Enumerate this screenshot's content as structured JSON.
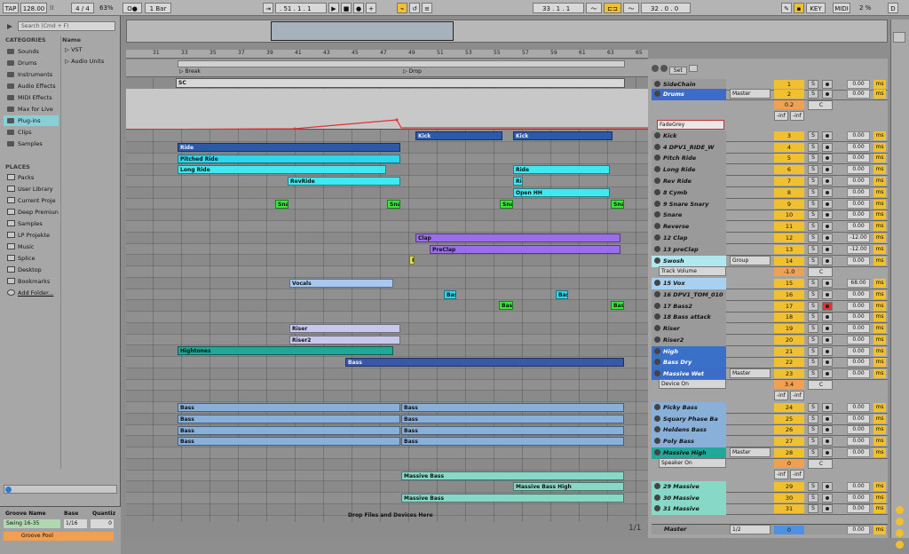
{
  "transport": {
    "tap": "TAP",
    "tempo": "128.00",
    "meter": "4 / 4",
    "zoom": "63%",
    "quantize": "1 Bar",
    "position": ". 51 .   1 .   1",
    "loop_start": "33 .   1 .   1",
    "loop_len": "32 .   0 .   0",
    "key": "KEY",
    "midi": "MIDI",
    "cpu": "2 %",
    "d": "D"
  },
  "browser": {
    "search_placeholder": "Search (Cmd + F)",
    "categories_title": "CATEGORIES",
    "categories": [
      "Sounds",
      "Drums",
      "Instruments",
      "Audio Effects",
      "MIDI Effects",
      "Max for Live",
      "Plug-ins",
      "Clips",
      "Samples"
    ],
    "name_header": "Name",
    "collection": [
      "VST",
      "Audio Units"
    ],
    "places_title": "PLACES",
    "places": [
      "Packs",
      "User Library",
      "Current Proje",
      "Deep Premiun",
      "Samples",
      "LP Projekte",
      "Music",
      "Splice",
      "Desktop",
      "Bookmarks",
      "Add Folder..."
    ]
  },
  "groove": {
    "header_name": "Groove Name",
    "header_base": "Base",
    "header_quant": "Quantiz",
    "groove_name": "Swing 16-35",
    "base": "1/16",
    "quant": "0",
    "pool": "Groove Pool"
  },
  "arrangement": {
    "ruler": [
      "31",
      "33",
      "35",
      "37",
      "39",
      "41",
      "43",
      "45",
      "47",
      "49",
      "51",
      "53",
      "55",
      "57",
      "59",
      "61",
      "63",
      "65"
    ],
    "locators": [
      "Break",
      "Drop"
    ],
    "footer": "Drop Files and Devices Here",
    "page": "1/1",
    "sidechain_clip": "SC"
  },
  "mixer": {
    "set_label": "Set",
    "master_name": "Master",
    "master_routing": "1/2",
    "master_num": "0",
    "master_vol": "0.00",
    "ms": "ms"
  },
  "clips": [
    {
      "text": "Kick",
      "lane": 4
    },
    {
      "text": "Kick",
      "lane": 4
    },
    {
      "text": "Ride",
      "lane": 5
    },
    {
      "text": "Pitched Ride",
      "lane": 6
    },
    {
      "text": "Long Ride",
      "lane": 7
    },
    {
      "text": "Ride",
      "lane": 7
    },
    {
      "text": "RevRide",
      "lane": 8
    },
    {
      "text": "Rid",
      "lane": 8
    },
    {
      "text": "Open HH",
      "lane": 9
    },
    {
      "text": "Snar",
      "lane": 10
    },
    {
      "text": "Snar",
      "lane": 10
    },
    {
      "text": "Snar",
      "lane": 10
    },
    {
      "text": "Snar",
      "lane": 10
    },
    {
      "text": "Clap",
      "lane": 13
    },
    {
      "text": "PreClap",
      "lane": 14
    },
    {
      "text": "R",
      "lane": 15
    },
    {
      "text": "Vocals",
      "lane": 17
    },
    {
      "text": "Bass",
      "lane": 18
    },
    {
      "text": "Bass",
      "lane": 18
    },
    {
      "text": "Bass",
      "lane": 19
    },
    {
      "text": "Bass",
      "lane": 19
    },
    {
      "text": "Riser",
      "lane": 21
    },
    {
      "text": "Riser2",
      "lane": 22
    },
    {
      "text": "Hightones",
      "lane": 23
    },
    {
      "text": "Bass",
      "lane": 24
    },
    {
      "text": "Bass",
      "lane": 28
    },
    {
      "text": "Bass",
      "lane": 28
    },
    {
      "text": "Bass",
      "lane": 29
    },
    {
      "text": "Bass",
      "lane": 29
    },
    {
      "text": "Bass",
      "lane": 30
    },
    {
      "text": "Bass",
      "lane": 30
    },
    {
      "text": "Bass",
      "lane": 31
    },
    {
      "text": "Bass",
      "lane": 31
    },
    {
      "text": "Massive Bass",
      "lane": 34
    },
    {
      "text": "Massive Bass High",
      "lane": 35
    },
    {
      "text": "Massive Bass",
      "lane": 36
    }
  ],
  "tracks": [
    {
      "name": "SideChain",
      "num": "1",
      "vol": "0.00"
    },
    {
      "name": "Drums",
      "num": "2",
      "vol": "0.00",
      "routing": "Master",
      "send": "0.2",
      "pan": "C",
      "inf1": "-inf",
      "inf2": "-inf",
      "device": "FadeGrey"
    },
    {
      "name": "Kick",
      "num": "3",
      "vol": "0.00"
    },
    {
      "name": "4 DPV1_RIDE_W",
      "num": "4",
      "vol": "0.00"
    },
    {
      "name": "Pitch Ride",
      "num": "5",
      "vol": "0.00"
    },
    {
      "name": "Long Ride",
      "num": "6",
      "vol": "0.00"
    },
    {
      "name": "Rev Ride",
      "num": "7",
      "vol": "0.00"
    },
    {
      "name": "8 Cymb",
      "num": "8",
      "vol": "0.00"
    },
    {
      "name": "9 Snare Snary",
      "num": "9",
      "vol": "0.00"
    },
    {
      "name": "Snare",
      "num": "10",
      "vol": "0.00"
    },
    {
      "name": "Reverse",
      "num": "11",
      "vol": "0.00"
    },
    {
      "name": "12 Clap",
      "num": "12",
      "vol": "-12.00"
    },
    {
      "name": "13 preClap",
      "num": "13",
      "vol": "-12.00"
    },
    {
      "name": "Swosh",
      "num": "14",
      "vol": "0.00",
      "routing": "Group",
      "device": "Track Volume",
      "send": "-1.0",
      "pan": "C"
    },
    {
      "name": "15 Vox",
      "num": "15",
      "vol": "68.00"
    },
    {
      "name": "16 DPV1_TOM_010",
      "num": "16",
      "vol": "0.00"
    },
    {
      "name": "17 Bass2",
      "num": "17",
      "vol": "0.00"
    },
    {
      "name": "18 Bass attack",
      "num": "18",
      "vol": "0.00"
    },
    {
      "name": "Riser",
      "num": "19",
      "vol": "0.00"
    },
    {
      "name": "Riser2",
      "num": "20",
      "vol": "0.00"
    },
    {
      "name": "High",
      "num": "21",
      "vol": "0.00"
    },
    {
      "name": "Bass Dry",
      "num": "22",
      "vol": "0.00"
    },
    {
      "name": "Massive Wet",
      "num": "23",
      "vol": "0.00",
      "routing": "Master",
      "device": "Device On",
      "send": "3.4",
      "pan": "C",
      "inf1": "-inf",
      "inf2": "-inf"
    },
    {
      "name": "Picky Bass",
      "num": "24",
      "vol": "0.00"
    },
    {
      "name": "Squary Phase Ba",
      "num": "25",
      "vol": "0.00"
    },
    {
      "name": "Heldens Bass",
      "num": "26",
      "vol": "0.00"
    },
    {
      "name": "Poly Bass",
      "num": "27",
      "vol": "0.00"
    },
    {
      "name": "Massive High",
      "num": "28",
      "vol": "0.00",
      "routing": "Master",
      "device": "Speaker On",
      "send": "0",
      "pan": "C",
      "inf1": "-inf",
      "inf2": "-inf"
    },
    {
      "name": "29 Massive",
      "num": "29",
      "vol": "0.00"
    },
    {
      "name": "30 Massive",
      "num": "30",
      "vol": "0.00"
    },
    {
      "name": "31 Massive",
      "num": "31",
      "vol": "0.00"
    }
  ]
}
